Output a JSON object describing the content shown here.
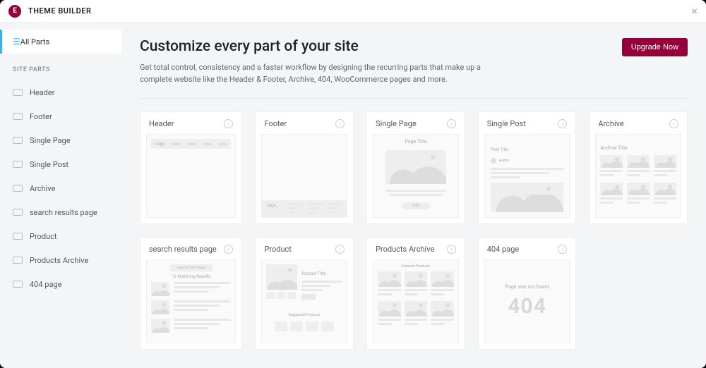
{
  "header": {
    "app_name": "THEME BUILDER",
    "logo_letter": "E"
  },
  "sidebar": {
    "all_parts_label": "All Parts",
    "section_label": "SITE PARTS",
    "items": [
      {
        "label": "Header"
      },
      {
        "label": "Footer"
      },
      {
        "label": "Single Page"
      },
      {
        "label": "Single Post"
      },
      {
        "label": "Archive"
      },
      {
        "label": "search results page"
      },
      {
        "label": "Product"
      },
      {
        "label": "Products Archive"
      },
      {
        "label": "404 page"
      }
    ]
  },
  "main": {
    "title": "Customize every part of your site",
    "description": "Get total control, consistency and a faster workflow by designing the recurring parts that make up a complete website like the Header & Footer, Archive, 404, WooCommerce pages and more.",
    "upgrade_label": "Upgrade Now"
  },
  "cards": [
    {
      "title": "Header",
      "preview": {
        "logo": "Logo"
      }
    },
    {
      "title": "Footer",
      "preview": {
        "logo": "Logo"
      }
    },
    {
      "title": "Single Page",
      "preview": {
        "page_title": "Page Title",
        "cta": "CTA"
      }
    },
    {
      "title": "Single Post",
      "preview": {
        "post_title": "Post Title",
        "author": "Author"
      }
    },
    {
      "title": "Archive",
      "preview": {
        "archive_title": "Archive Title"
      }
    },
    {
      "title": "search results page",
      "preview": {
        "search_placeholder": "Search Your Page",
        "results_text": "12 Matching Results"
      }
    },
    {
      "title": "Product",
      "preview": {
        "product_title": "Product Title",
        "suggested_label": "Suggested Products"
      }
    },
    {
      "title": "Products Archive",
      "preview": {
        "featured_label": "Featured Products"
      }
    },
    {
      "title": "404 page",
      "preview": {
        "not_found": "Page was not found",
        "code": "404"
      }
    }
  ],
  "colors": {
    "brand": "#95003a",
    "accent": "#3bb0eb"
  }
}
